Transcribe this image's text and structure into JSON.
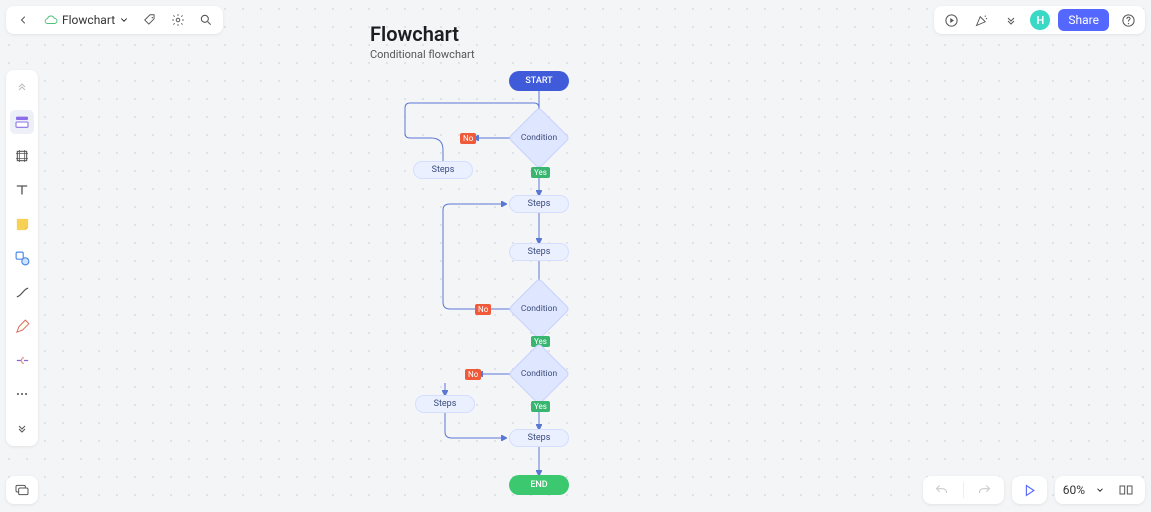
{
  "doc": {
    "title": "Flowchart"
  },
  "canvas": {
    "title": "Flowchart",
    "subtitle": "Conditional flowchart"
  },
  "topRight": {
    "avatar": "H",
    "share": "Share"
  },
  "zoom": {
    "value": "60%"
  },
  "flow": {
    "start": "START",
    "end": "END",
    "condition1": "Condition",
    "condition2": "Condition",
    "condition3": "Condition",
    "steps1": "Steps",
    "steps2": "Steps",
    "steps3": "Steps",
    "steps4": "Steps",
    "steps5": "Steps",
    "no": "No",
    "yes": "Yes"
  },
  "chart_data": {
    "type": "flowchart",
    "title": "Flowchart",
    "subtitle": "Conditional flowchart",
    "nodes": [
      {
        "id": "start",
        "kind": "terminator",
        "label": "START"
      },
      {
        "id": "cond1",
        "kind": "decision",
        "label": "Condition"
      },
      {
        "id": "steps_no1",
        "kind": "process",
        "label": "Steps"
      },
      {
        "id": "steps2",
        "kind": "process",
        "label": "Steps"
      },
      {
        "id": "steps3",
        "kind": "process",
        "label": "Steps"
      },
      {
        "id": "cond2",
        "kind": "decision",
        "label": "Condition"
      },
      {
        "id": "cond3",
        "kind": "decision",
        "label": "Condition"
      },
      {
        "id": "steps_no3",
        "kind": "process",
        "label": "Steps"
      },
      {
        "id": "steps5",
        "kind": "process",
        "label": "Steps"
      },
      {
        "id": "end",
        "kind": "terminator",
        "label": "END"
      }
    ],
    "edges": [
      {
        "from": "start",
        "to": "cond1"
      },
      {
        "from": "cond1",
        "to": "steps_no1",
        "label": "No"
      },
      {
        "from": "steps_no1",
        "to": "cond1",
        "loop": true
      },
      {
        "from": "cond1",
        "to": "steps2",
        "label": "Yes"
      },
      {
        "from": "steps2",
        "to": "steps3"
      },
      {
        "from": "steps3",
        "to": "cond2"
      },
      {
        "from": "cond2",
        "to": "steps2",
        "label": "No",
        "loop": true
      },
      {
        "from": "cond2",
        "to": "cond3",
        "label": "Yes"
      },
      {
        "from": "cond3",
        "to": "steps_no3",
        "label": "No"
      },
      {
        "from": "steps_no3",
        "to": "steps5",
        "loop": true
      },
      {
        "from": "cond3",
        "to": "steps5",
        "label": "Yes"
      },
      {
        "from": "steps5",
        "to": "end"
      }
    ]
  }
}
